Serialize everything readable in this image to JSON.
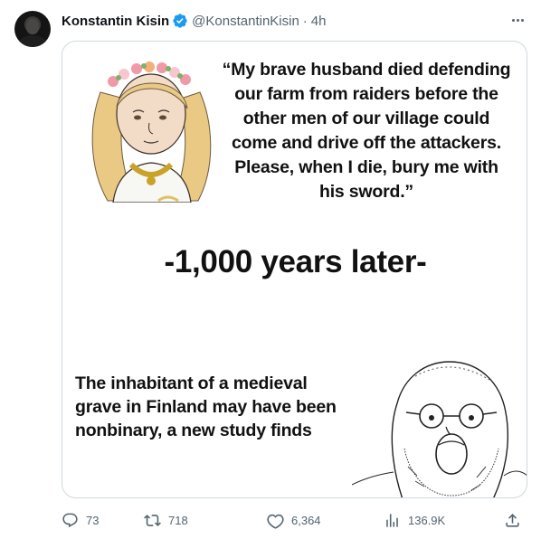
{
  "author": {
    "display_name": "Konstantin Kisin",
    "handle": "@KonstantinKisin",
    "separator": "·",
    "time": "4h",
    "verified_color": "#1d9bf0"
  },
  "meme": {
    "top_text": "“My brave husband died defending our farm from raiders before the other men of our village could come and drive off the attackers. Please, when I die, bury me with his sword.”",
    "middle_text": "-1,000 years later-",
    "bottom_text": "The inhabitant of a medieval grave in Finland may have been nonbinary, a new study finds"
  },
  "actions": {
    "replies": "73",
    "retweets": "718",
    "likes": "6,364",
    "views": "136.9K"
  },
  "colors": {
    "text_primary": "#0f1419",
    "text_secondary": "#536471",
    "border": "#cfd9de"
  }
}
